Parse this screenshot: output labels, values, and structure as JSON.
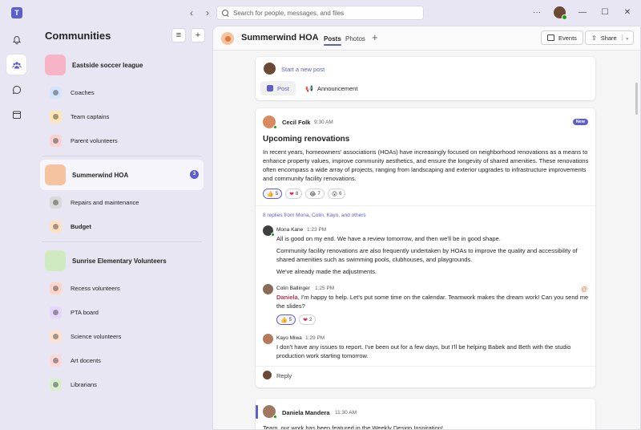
{
  "titlebar": {
    "search_placeholder": "Search for people, messages, and files"
  },
  "pane": {
    "title": "Communities",
    "groups": [
      {
        "label": "Eastside soccer league",
        "avatar_color": "#f7b4c7",
        "channels": [
          {
            "label": "Coaches",
            "color": "#d4e4ff"
          },
          {
            "label": "Team captains",
            "color": "#fde7b6"
          },
          {
            "label": "Parent volunteers",
            "color": "#f9d3d3"
          }
        ]
      },
      {
        "label": "Summerwind HOA",
        "avatar_color": "#f6c3a0",
        "badge": "3",
        "channels": [
          {
            "label": "Repairs and maintenance",
            "color": "#d9d9d9"
          },
          {
            "label": "Budget",
            "color": "#fde1c4",
            "bold": true
          }
        ]
      },
      {
        "label": "Sunrise Elementary Volunteers",
        "avatar_color": "#cfeac1",
        "channels": [
          {
            "label": "Recess volunteers",
            "color": "#fbd6c8"
          },
          {
            "label": "PTA board",
            "color": "#e4d7fb"
          },
          {
            "label": "Science volunteers",
            "color": "#fde2cf"
          },
          {
            "label": "Art docents",
            "color": "#fcd9d9"
          },
          {
            "label": "Librarians",
            "color": "#d8eecf"
          }
        ]
      }
    ]
  },
  "main": {
    "title": "Summerwind HOA",
    "tabs": [
      "Posts",
      "Photos"
    ],
    "events_label": "Events",
    "share_label": "Share",
    "compose": {
      "start_label": "Start a new post",
      "post_label": "Post",
      "announcement_label": "Announcement"
    },
    "post": {
      "author": "Cecil Folk",
      "time": "9:30 AM",
      "badge": "New",
      "title": "Upcoming renovations",
      "body": "In recent years, homeowners' associations (HOAs) have increasingly focused on neighborhood renovations as a means to enhance property values, improve community aesthetics, and ensure the longevity of shared amenities. These renovations often encompass a wide array of projects, ranging from landscaping and exterior upgrades to infrastructure improvements and community facility renovations.",
      "reactions": [
        {
          "emoji": "👍",
          "count": "5"
        },
        {
          "emoji": "❤",
          "count": "8"
        },
        {
          "emoji": "😂",
          "count": "7"
        },
        {
          "emoji": "😮",
          "count": "6"
        }
      ],
      "replies_summary": "8 replies from Mona, Colin, Kayo, and others",
      "replies": [
        {
          "author": "Mona Kane",
          "time": "1:23 PM",
          "lines": [
            "All is good on my end. We have a review tomorrow, and then we'll be in good shape.",
            "Community facility renovations are also frequently undertaken by HOAs to improve the quality and accessibility of shared amenities such as swimming pools, clubhouses, and playgrounds.",
            "We've already made the adjustments."
          ]
        },
        {
          "author": "Colin Ballinger",
          "time": "1:25 PM",
          "mention": "Daniela",
          "text": ", I'm happy to help. Let's put some time on the calendar. Teamwork makes the dream work! Can you send me the slides?",
          "reactions": [
            {
              "emoji": "👍",
              "count": "5"
            },
            {
              "emoji": "❤",
              "count": "2"
            }
          ]
        },
        {
          "author": "Kayo Miwa",
          "time": "1:29 PM",
          "text": "I don't have any issues to report. I've been out for a few days, but I'll be helping Babek and Beth with the studio production work starting tomorrow."
        }
      ],
      "reply_label": "Reply"
    },
    "post2": {
      "author": "Daniela Mandera",
      "time": "11:30 AM",
      "body": "Team, our work has been featured in the Weekly Design Inspiration!"
    }
  }
}
